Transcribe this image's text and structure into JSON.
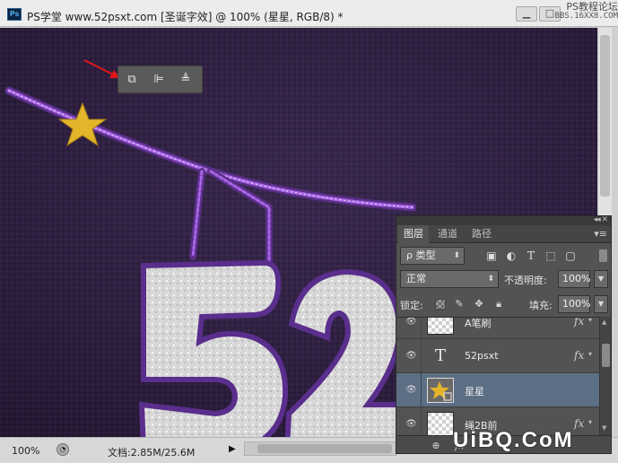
{
  "window": {
    "app_icon_label": "Ps",
    "title": "PS学堂 www.52psxt.com [圣诞字效] @ 100% (星星, RGB/8) *",
    "minimize_symbol": "▁",
    "maximize_symbol": "□"
  },
  "watermark_top": {
    "line1": "PS教程论坛",
    "line2": "BBS.16XX8.COM"
  },
  "canvas": {
    "text_fragment": "52",
    "star_color": "#e3b52a",
    "background_color": "#2d1e3c",
    "garland_color": "#9b57d8",
    "letter_color": "#d8d8d8"
  },
  "float_toolbar": {
    "icons": [
      "align-layers-icon",
      "align-left-edges-icon",
      "distribute-layers-icon"
    ]
  },
  "status": {
    "zoom": "100%",
    "doc_info": "文档:2.85M/25.6M",
    "arrow": "▶"
  },
  "layers_panel": {
    "tabs": [
      "图层",
      "通道",
      "路径"
    ],
    "active_tab": "图层",
    "filter_label": "类型",
    "filter_symbol": "ρ",
    "blend_mode": "正常",
    "opacity_label": "不透明度:",
    "opacity_value": "100%",
    "lock_label": "锁定:",
    "fill_label": "填充:",
    "fill_value": "100%",
    "layers": [
      {
        "name": "A笔刷",
        "type": "pixel",
        "fx": "fx",
        "selected": false
      },
      {
        "name": "52psxt",
        "type": "text",
        "fx": "fx",
        "selected": false
      },
      {
        "name": "星星",
        "type": "shape",
        "fx": "",
        "selected": true
      },
      {
        "name": "绳2B前",
        "type": "pixel",
        "fx": "fx",
        "selected": false
      }
    ],
    "text_layer_glyph": "T",
    "fx_symbol": "fx",
    "link_symbol": "⊕"
  },
  "watermark_bottom": {
    "text": "UiBQ.CoM"
  }
}
